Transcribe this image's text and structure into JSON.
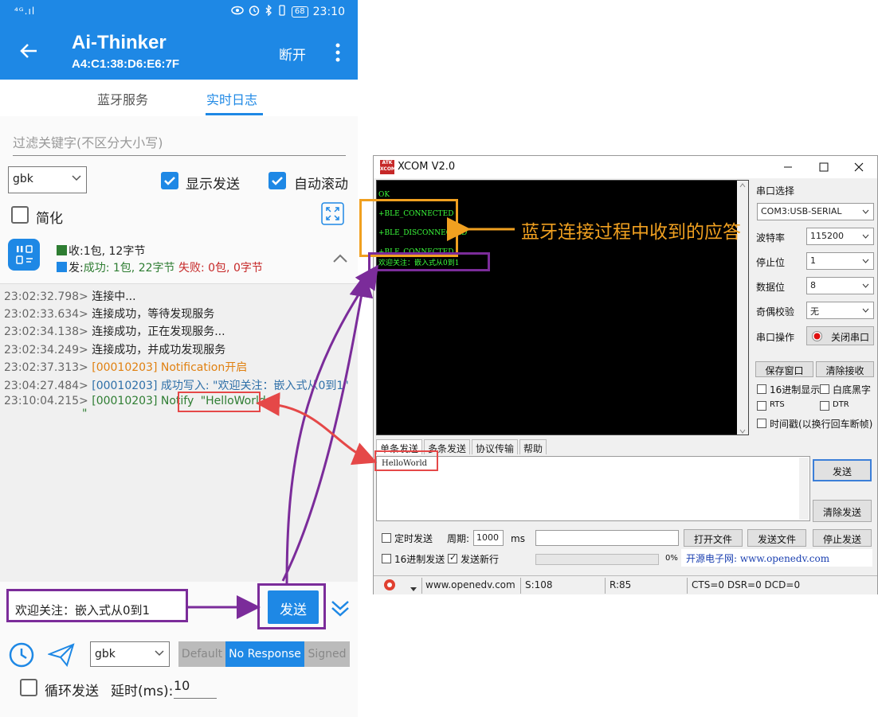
{
  "phone": {
    "status_bar": {
      "signal": "⁴ᴳ.ıl",
      "battery": "68",
      "time": "23:10"
    },
    "app_bar": {
      "title": "Ai-Thinker",
      "subtitle": "A4:C1:38:D6:E6:7F",
      "disconnect_label": "断开"
    },
    "tabs": [
      {
        "label": "蓝牙服务",
        "active": false
      },
      {
        "label": "实时日志",
        "active": true
      }
    ],
    "filter_placeholder": "过滤关键字(不区分大小写)",
    "encoding_select": "gbk",
    "show_send": {
      "label": "显示发送",
      "checked": true
    },
    "auto_scroll": {
      "label": "自动滚动",
      "checked": true
    },
    "simplify": {
      "label": "简化",
      "checked": false
    },
    "stats": {
      "recv_prefix": "收:",
      "recv_text": "1包, 12字节",
      "send_prefix": "发:",
      "send_success": "成功: 1包, 22字节",
      "send_fail": "失败: 0包, 0字节"
    },
    "log": [
      {
        "ts": "23:02:32.798>",
        "msg": "连接中...",
        "color": "default"
      },
      {
        "ts": "23:02:33.634>",
        "msg": "连接成功，等待发现服务",
        "color": "default"
      },
      {
        "ts": "23:02:34.138>",
        "msg": "连接成功，正在发现服务...",
        "color": "default"
      },
      {
        "ts": "23:02:34.249>",
        "msg": "连接成功，并成功发现服务",
        "color": "default"
      },
      {
        "ts": "23:02:37.313>",
        "msg": "[00010203] Notification开启",
        "color": "orange"
      },
      {
        "ts": "23:04:27.484>",
        "msg": "[00010203] 成功写入: \"欢迎关注：嵌入式从0到1\"",
        "color": "blue"
      },
      {
        "ts": "23:10:04.215>",
        "msg": "[00010203] Notify",
        "highlight": "\"HelloWorld",
        "continuation": "\"",
        "color": "green"
      }
    ],
    "send_input_value": "欢迎关注：嵌入式从0到1",
    "send_button": "发送",
    "bottom": {
      "encoding": "gbk",
      "write_types": [
        "Default",
        "No Response",
        "Signed"
      ],
      "active_write_type": "No Response",
      "loop_send": {
        "label": "循环发送",
        "checked": false
      },
      "delay_label": "延时(ms):",
      "delay_value": "10"
    }
  },
  "xcom": {
    "title": "XCOM V2.0",
    "logo_text": "ATK XCOM",
    "console_lines": [
      "OK",
      "+BLE_CONNECTED",
      "+BLE_DISCONNECTED",
      "+BLE_CONNECTED",
      "欢迎关注：嵌入式从0到1"
    ],
    "right_panel": {
      "port_select_label": "串口选择",
      "port_value": "COM3:USB-SERIAL",
      "baud_label": "波特率",
      "baud_value": "115200",
      "stopbits_label": "停止位",
      "stopbits_value": "1",
      "databits_label": "数据位",
      "databits_value": "8",
      "parity_label": "奇偶校验",
      "parity_value": "无",
      "port_op_label": "串口操作",
      "close_port_button": "关闭串口",
      "save_window_button": "保存窗口",
      "clear_recv_button": "清除接收",
      "hex_display": {
        "label": "16进制显示",
        "checked": false
      },
      "white_bg": {
        "label": "白底黑字",
        "checked": false
      },
      "rts": {
        "label": "RTS",
        "checked": false
      },
      "dtr": {
        "label": "DTR",
        "checked": false
      },
      "timestamp": {
        "label": "时间戳(以换行回车断帧)",
        "checked": false
      }
    },
    "send_tabs": [
      "单条发送",
      "多条发送",
      "协议传输",
      "帮助"
    ],
    "send_text": "HelloWorld",
    "send_button": "发送",
    "clear_send_button": "清除发送",
    "timed_send": {
      "label": "定时发送",
      "checked": false
    },
    "period_label": "周期:",
    "period_value": "1000",
    "period_unit": "ms",
    "open_file_button": "打开文件",
    "send_file_button": "发送文件",
    "stop_send_button": "停止发送",
    "hex_send": {
      "label": "16进制发送",
      "checked": false
    },
    "newline_send": {
      "label": "发送新行",
      "checked": true
    },
    "progress_percent": "0%",
    "progress_value": 0,
    "site_banner": "开源电子网: www.openedv.com",
    "status_bar": {
      "site": "www.openedv.com",
      "sent": "S:108",
      "received": "R:85",
      "signals": "CTS=0 DSR=0 DCD=0"
    }
  },
  "annotation": {
    "label": "蓝牙连接过程中收到的应答",
    "color": "#f0a020"
  },
  "colors": {
    "brand_blue": "#1e88e5",
    "annotation_purple": "#7b2c9a",
    "annotation_red": "#e54848",
    "console_green": "#3cff3c"
  }
}
